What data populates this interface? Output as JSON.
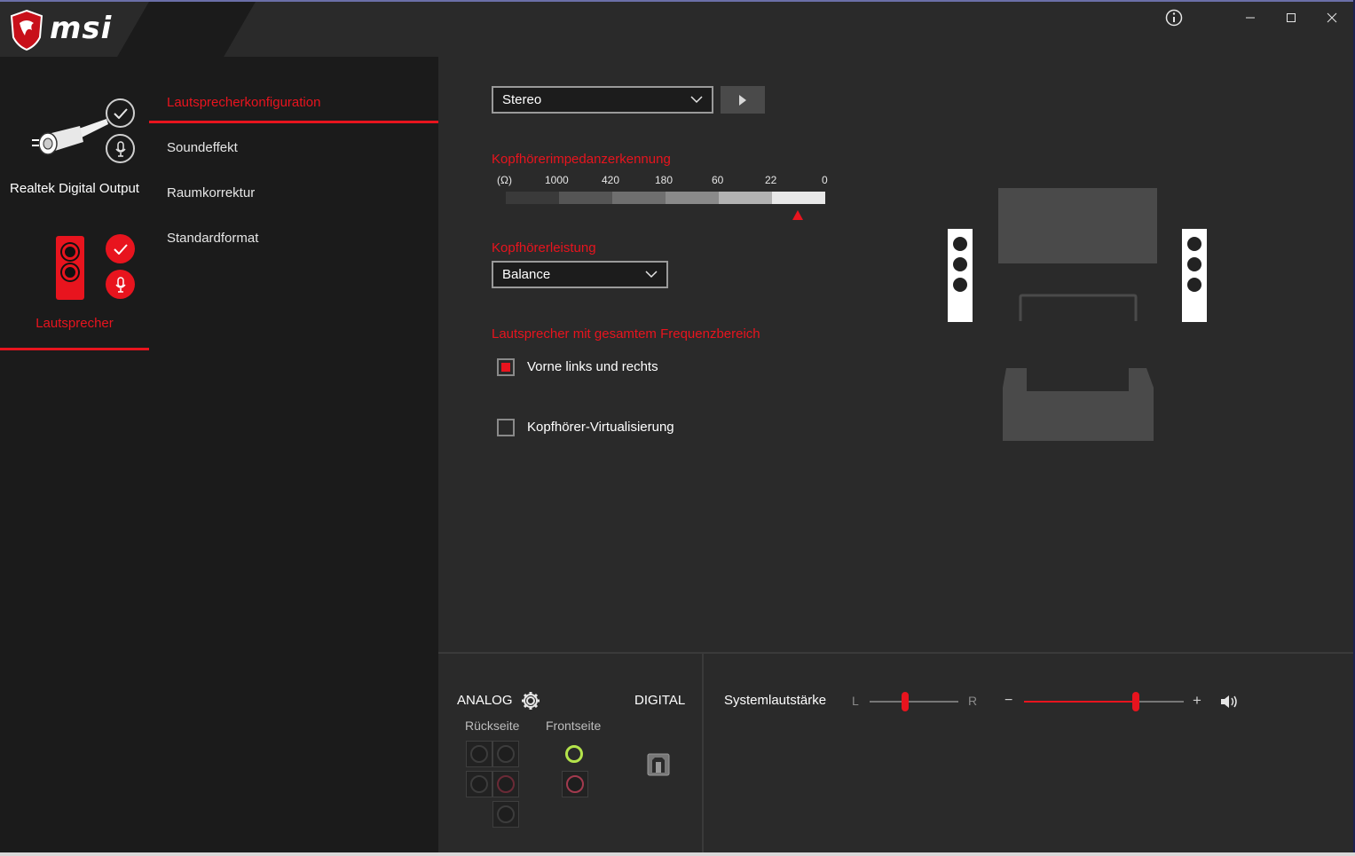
{
  "brand": {
    "name": "msi",
    "accent_color": "#e8141e"
  },
  "devices": [
    {
      "label": "Realtek Digital Output",
      "active": false
    },
    {
      "label": "Lautsprecher",
      "active": true
    }
  ],
  "menu": {
    "items": [
      {
        "label": "Lautsprecherkonfiguration",
        "active": true
      },
      {
        "label": "Soundeffekt",
        "active": false
      },
      {
        "label": "Raumkorrektur",
        "active": false
      },
      {
        "label": "Standardformat",
        "active": false
      }
    ]
  },
  "titlebar": {
    "icons": [
      "info-icon",
      "minimize-icon",
      "maximize-icon",
      "close-icon"
    ]
  },
  "config": {
    "speaker_select": "Stereo",
    "impedance": {
      "heading": "Kopfhörerimpedanzerkennung",
      "unit": "(Ω)",
      "ticks": [
        "1000",
        "420",
        "180",
        "60",
        "22",
        "0"
      ]
    },
    "power": {
      "heading": "Kopfhörerleistung",
      "value": "Balance"
    },
    "fullrange": {
      "heading": "Lautsprecher mit gesamtem Frequenzbereich",
      "options": [
        {
          "label": "Vorne links und rechts",
          "checked": true
        },
        {
          "label": "Kopfhörer-Virtualisierung",
          "checked": false
        }
      ]
    }
  },
  "connectors": {
    "analog_label": "ANALOG",
    "digital_label": "DIGITAL",
    "rear_label": "Rückseite",
    "front_label": "Frontseite"
  },
  "volume": {
    "label": "Systemlautstärke",
    "left_label": "L",
    "right_label": "R",
    "minus": "−",
    "plus": "+",
    "balance": 0.4,
    "level": 0.7
  }
}
